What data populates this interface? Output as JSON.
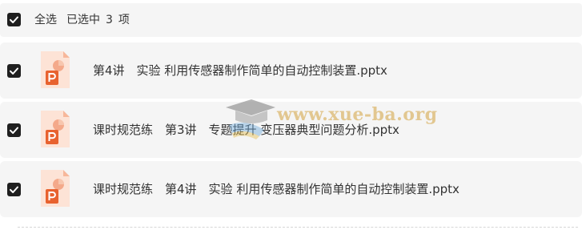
{
  "header": {
    "select_all_label": "全选",
    "selected_prefix": "已选中",
    "selected_count": "3",
    "selected_suffix": "项"
  },
  "files": [
    {
      "name": "第4讲　实验 利用传感器制作简单的自动控制装置.pptx",
      "checked": true,
      "type_icon": "pptx-file-icon"
    },
    {
      "name": "课时规范练　第3讲　专题提升 变压器典型问题分析.pptx",
      "checked": true,
      "type_icon": "pptx-file-icon"
    },
    {
      "name": "课时规范练　第4讲　实验 利用传感器制作简单的自动控制装置.pptx",
      "checked": true,
      "type_icon": "pptx-file-icon"
    }
  ],
  "watermark": {
    "text": "www.xue-ba.org"
  },
  "colors": {
    "row_background": "#f5f5f5",
    "checkbox": "#1f1f1f",
    "pptx_orange": "#e8622f",
    "pptx_light": "#fde3d6"
  }
}
